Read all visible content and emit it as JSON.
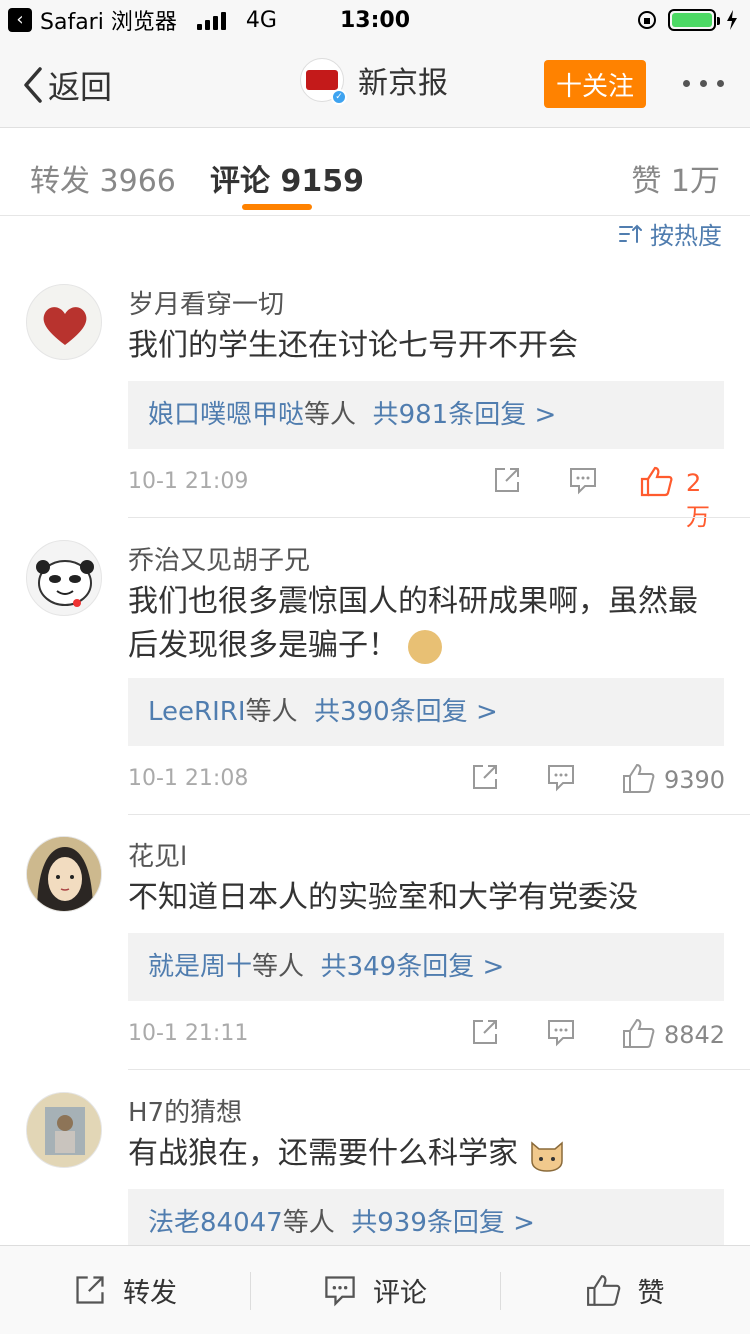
{
  "status_bar": {
    "carrier": "Safari 浏览器",
    "network": "4G",
    "time": "13:00"
  },
  "nav": {
    "back_label": "返回",
    "account_name": "新京报",
    "follow_label": "十关注"
  },
  "tabs": {
    "repost": "转发 3966",
    "comments": "评论 9159",
    "likes": "赞 1万"
  },
  "sort_label": "按热度",
  "comments": [
    {
      "user": "岁月看穿一切",
      "text": "我们的学生还在讨论七号开不开会",
      "reply_names": "娘口噗嗯甲哒",
      "reply_etc": "等人",
      "reply_count": "共981条回复 >",
      "time": "10-1 21:09",
      "likes": "2万"
    },
    {
      "user": "乔治又见胡子兄",
      "text": "我们也很多震惊国人的科研成果啊，虽然最后发现很多是骗子！",
      "reply_names": "LeeRIRI",
      "reply_etc": "等人",
      "reply_count": "共390条回复 >",
      "time": "10-1 21:08",
      "likes": "9390"
    },
    {
      "user": "花见l",
      "text": "不知道日本人的实验室和大学有党委没",
      "reply_names": "就是周十",
      "reply_etc": "等人",
      "reply_count": "共349条回复 >",
      "time": "10-1 21:11",
      "likes": "8842"
    },
    {
      "user": "H7的猜想",
      "text": "有战狼在，还需要什么科学家",
      "reply_names": "法老84047",
      "reply_etc": "等人",
      "reply_count": "共939条回复 >"
    }
  ],
  "bottom_bar": {
    "repost": "转发",
    "comment": "评论",
    "like": "赞"
  },
  "colors": {
    "accent": "#ff8200",
    "link": "#507daf",
    "hot_like": "#ff5b2e"
  }
}
